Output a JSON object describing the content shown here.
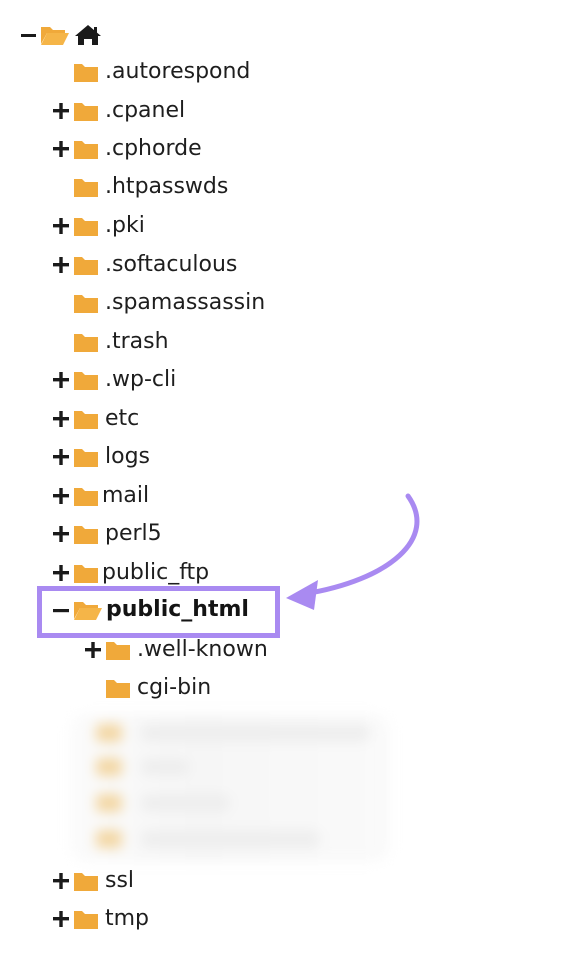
{
  "colors": {
    "folder": "#f0a93a",
    "accent_purple": "#a98af1",
    "text": "#1e1e1e"
  },
  "tree": {
    "root": {
      "toggle_icon": "minus-icon",
      "folder_icon": "folder-open-icon",
      "home_icon": "home-icon"
    },
    "items": [
      {
        "label": ".autorespond",
        "toggle": "none",
        "folder": "folder-icon"
      },
      {
        "label": ".cpanel",
        "toggle": "plus-icon",
        "folder": "folder-icon"
      },
      {
        "label": ".cphorde",
        "toggle": "plus-icon",
        "folder": "folder-icon"
      },
      {
        "label": ".htpasswds",
        "toggle": "none",
        "folder": "folder-icon"
      },
      {
        "label": ".pki",
        "toggle": "plus-icon",
        "folder": "folder-icon"
      },
      {
        "label": ".softaculous",
        "toggle": "plus-icon",
        "folder": "folder-icon"
      },
      {
        "label": ".spamassassin",
        "toggle": "none",
        "folder": "folder-icon"
      },
      {
        "label": ".trash",
        "toggle": "none",
        "folder": "folder-icon"
      },
      {
        "label": ".wp-cli",
        "toggle": "plus-icon",
        "folder": "folder-icon"
      },
      {
        "label": "etc",
        "toggle": "plus-icon",
        "folder": "folder-icon"
      },
      {
        "label": "logs",
        "toggle": "plus-icon",
        "folder": "folder-icon"
      },
      {
        "label": "mail",
        "toggle": "plus-icon",
        "folder": "folder-icon"
      },
      {
        "label": "perl5",
        "toggle": "plus-icon",
        "folder": "folder-icon"
      },
      {
        "label": "public_ftp",
        "toggle": "plus-icon",
        "folder": "folder-icon"
      },
      {
        "label": "public_html",
        "toggle": "minus-icon",
        "folder": "folder-open-icon",
        "selected": true
      },
      {
        "label": ".well-known",
        "toggle": "plus-icon",
        "folder": "folder-icon"
      },
      {
        "label": "cgi-bin",
        "toggle": "none",
        "folder": "folder-icon"
      },
      {
        "label": "ssl",
        "toggle": "plus-icon",
        "folder": "folder-icon"
      },
      {
        "label": "tmp",
        "toggle": "plus-icon",
        "folder": "folder-icon"
      }
    ]
  },
  "annotation": {
    "highlight": "public_html",
    "arrow_icon": "curved-arrow-icon",
    "blurred_region": "redacted-folder-list"
  }
}
